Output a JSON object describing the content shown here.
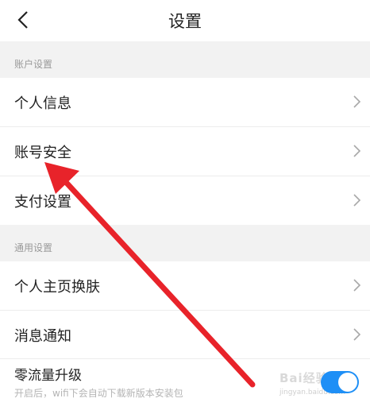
{
  "header": {
    "title": "设置",
    "back_icon": "chevron-left-icon"
  },
  "sections": {
    "account": "账户设置",
    "general": "通用设置"
  },
  "rows": {
    "personal_info": "个人信息",
    "account_security": "账号安全",
    "payment_settings": "支付设置",
    "homepage_skin": "个人主页换肤",
    "notifications": "消息通知"
  },
  "zero_traffic": {
    "title": "零流量升级",
    "description": "开启后，wifi下会自动下载新版本安装包",
    "enabled": true
  },
  "watermark": {
    "brand": "Bai经验",
    "url": "jingyan.baidu.com"
  },
  "colors": {
    "accent": "#1e8ff6",
    "annotation_arrow": "#e8232a",
    "section_bg": "#f2f2f2"
  }
}
